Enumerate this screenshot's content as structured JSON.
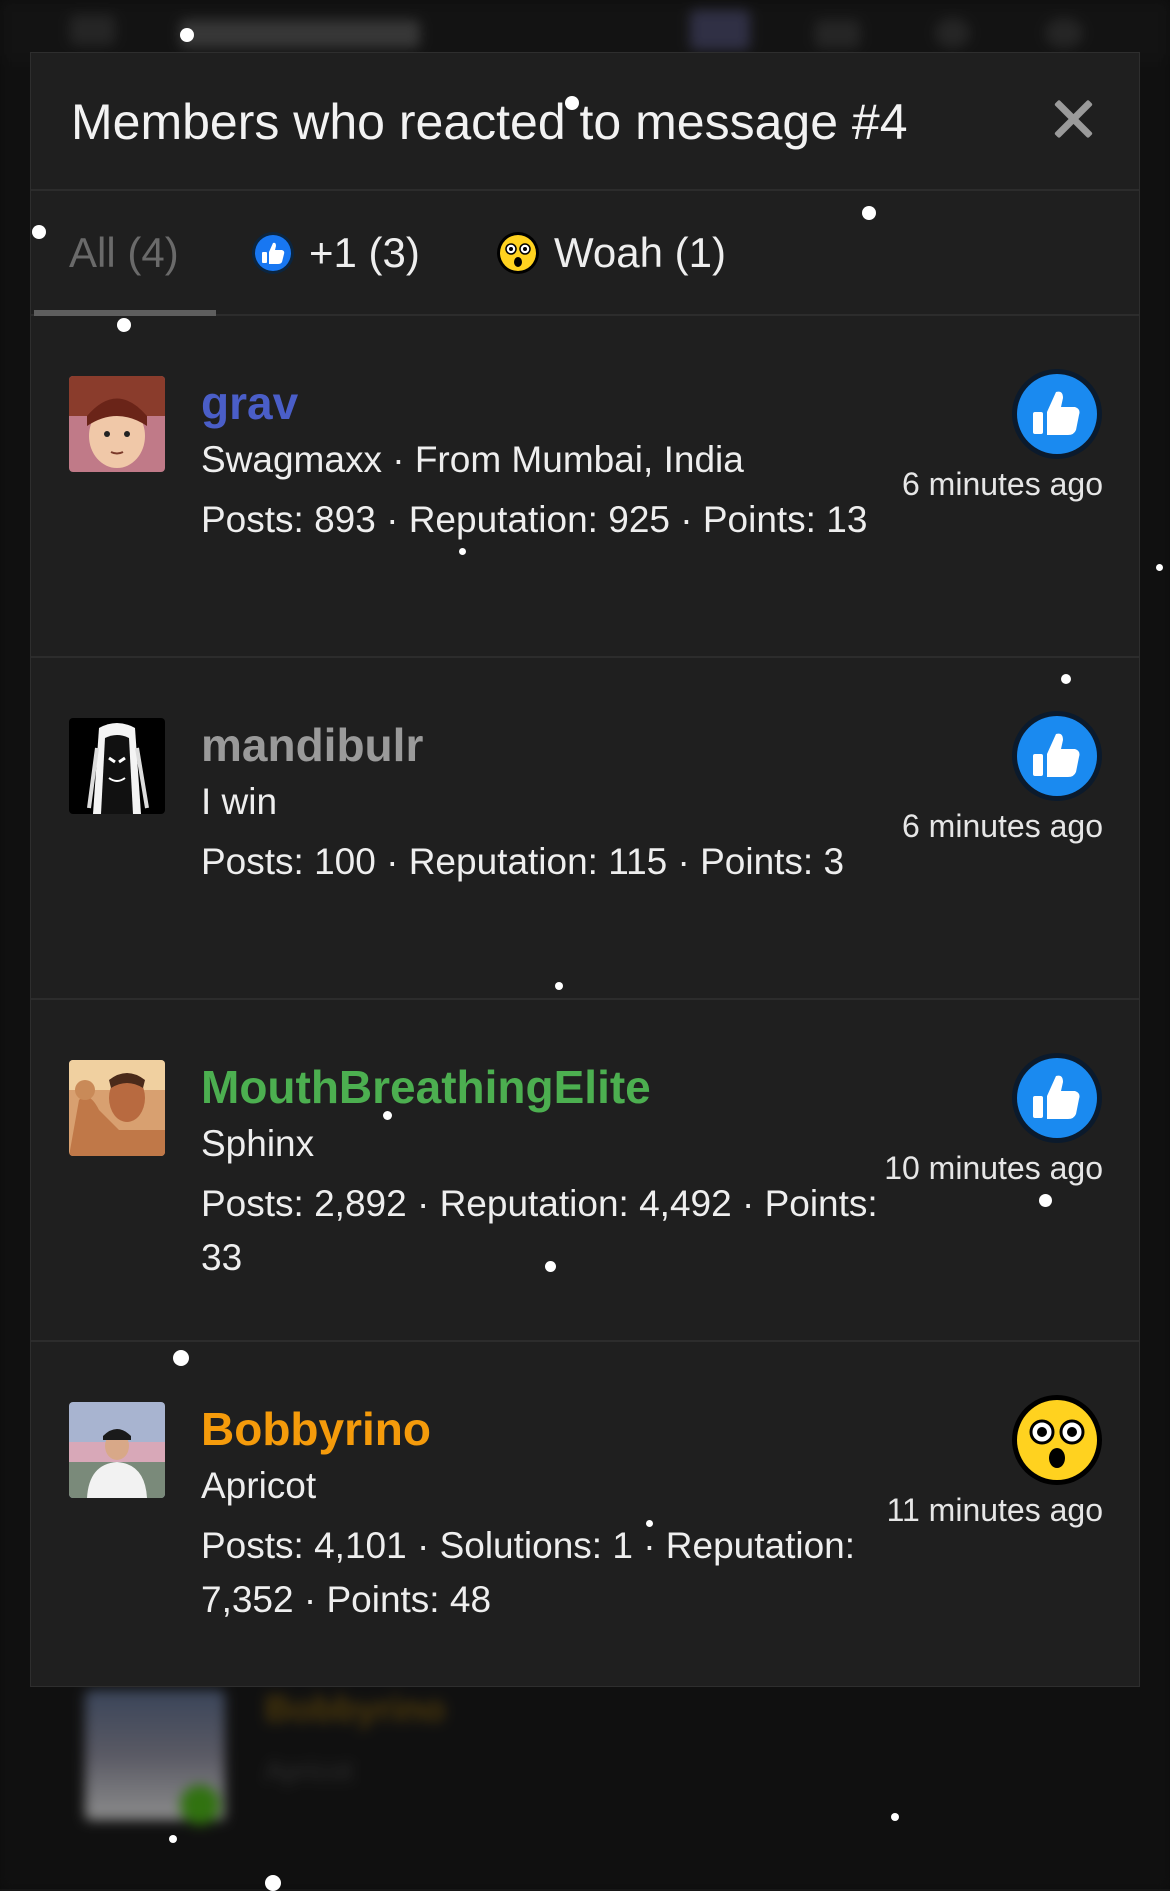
{
  "modal": {
    "title": "Members who reacted to message #4",
    "close_icon": "close-icon"
  },
  "tabs": [
    {
      "label": "All (4)",
      "icon": null,
      "active": true
    },
    {
      "label": "+1 (3)",
      "icon": "thumbs-up-icon",
      "active": false
    },
    {
      "label": "Woah (1)",
      "icon": "astonished-face-icon",
      "active": false
    }
  ],
  "members": [
    {
      "name": "grav",
      "name_color": "#4a5ec8",
      "title": "Swagmaxx · From Mumbai, India",
      "stats": "Posts: 893 · Reputation: 925 · Points: 13",
      "reaction": "thumbs-up-icon",
      "time": "6 minutes ago"
    },
    {
      "name": "mandibulr",
      "name_color": "#9a9a9a",
      "title": "I win",
      "stats": "Posts: 100 · Reputation: 115 · Points: 3",
      "reaction": "thumbs-up-icon",
      "time": "6 minutes ago"
    },
    {
      "name": "MouthBreathingElite",
      "name_color": "#4caf50",
      "title": "Sphinx",
      "stats": "Posts: 2,892 · Reputation: 4,492 · Points: 33",
      "reaction": "thumbs-up-icon",
      "time": "10 minutes ago"
    },
    {
      "name": "Bobbyrino",
      "name_color": "#f59b0b",
      "title": "Apricot",
      "stats": "Posts: 4,101 · Solutions: 1 · Reputation: 7,352 · Points: 48",
      "reaction": "astonished-face-icon",
      "time": "11 minutes ago"
    }
  ],
  "background": {
    "name": "Bobbyrino",
    "title": "Apricot"
  },
  "colors": {
    "modal_bg": "#1f1f1f",
    "like_blue": "#1877f2",
    "woah_yellow": "#ffd21f"
  }
}
